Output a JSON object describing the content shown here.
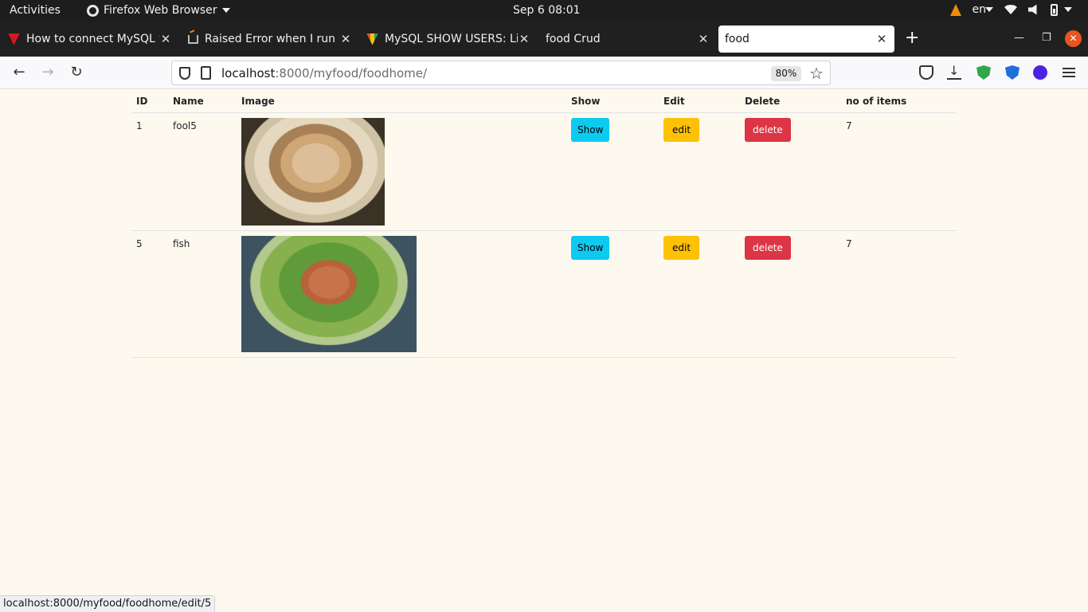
{
  "system": {
    "activities": "Activities",
    "app_name": "Firefox Web Browser",
    "clock": "Sep 6  08:01",
    "language": "en"
  },
  "tabs": [
    {
      "title": "How to connect MySQL to",
      "icon": "opera-icon"
    },
    {
      "title": "Raised Error when I run p",
      "icon": "stackoverflow-icon"
    },
    {
      "title": "MySQL SHOW USERS: List",
      "icon": "mysql-icon"
    },
    {
      "title": "food Crud",
      "icon": ""
    },
    {
      "title": "food",
      "icon": ""
    }
  ],
  "nav": {
    "url_host": "localhost",
    "url_rest": ":8000/myfood/foodhome/",
    "zoom": "80%"
  },
  "table": {
    "headers": [
      "ID",
      "Name",
      "Image",
      "Show",
      "Edit",
      "Delete",
      "no of items"
    ],
    "rows": [
      {
        "id": "1",
        "name": "fool5",
        "show": "Show",
        "edit": "edit",
        "delete": "delete",
        "items": "7"
      },
      {
        "id": "5",
        "name": "fish",
        "show": "Show",
        "edit": "edit",
        "delete": "delete",
        "items": "7"
      }
    ]
  },
  "status_url": "localhost:8000/myfood/foodhome/edit/5",
  "colors": {
    "page_bg": "#fdf9ee",
    "show": "#0dcaf0",
    "edit": "#ffc107",
    "delete": "#dc3545",
    "ubuntu_close": "#e95420"
  }
}
